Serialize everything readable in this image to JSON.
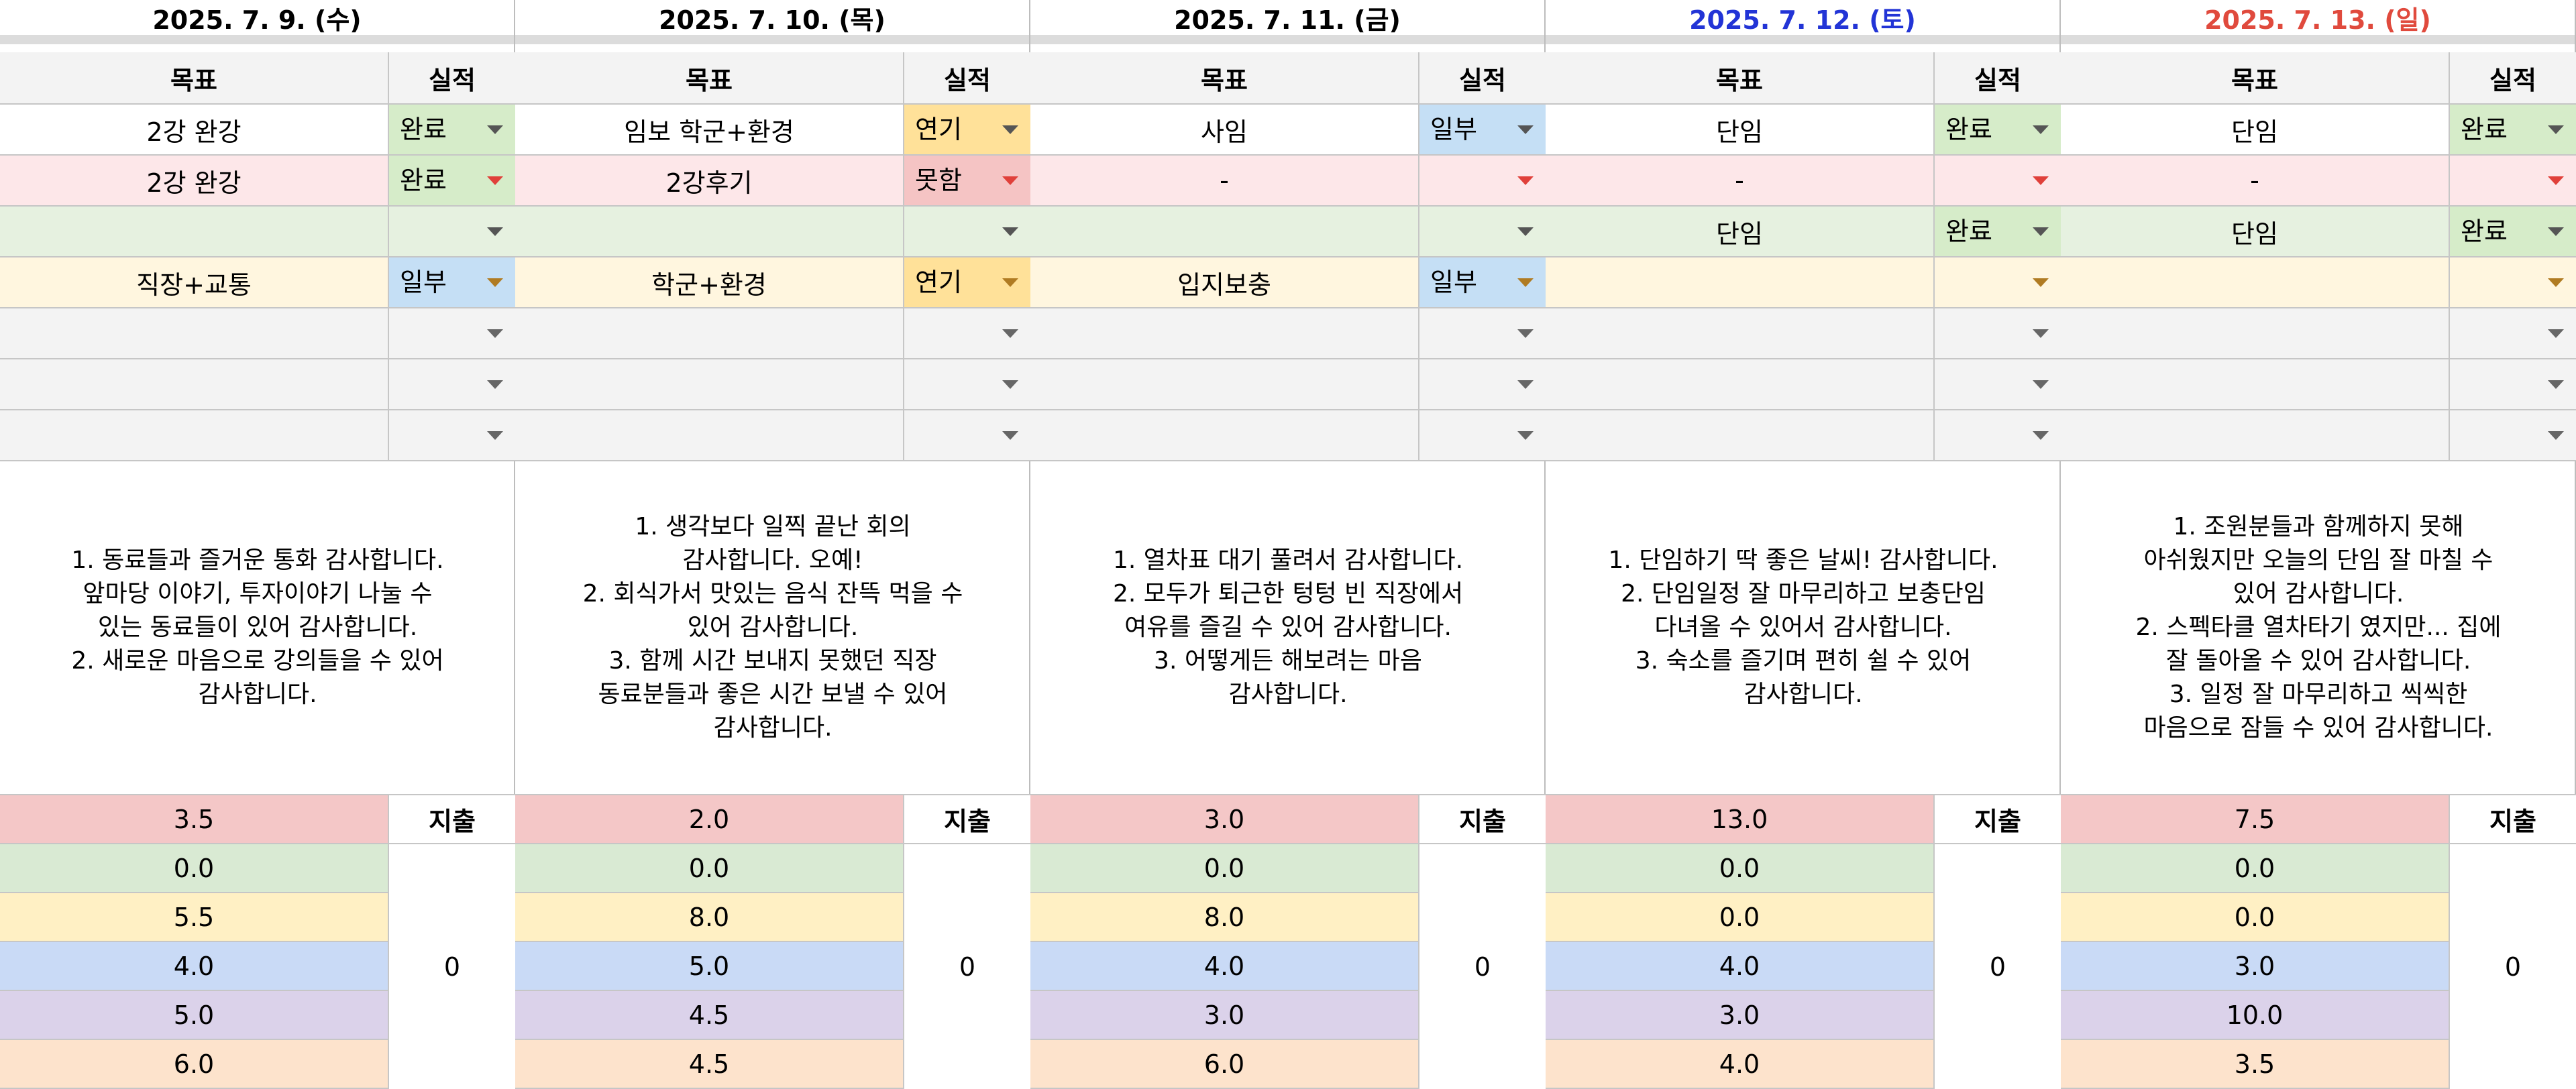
{
  "headers": {
    "goal": "목표",
    "result": "실적",
    "spend": "지출"
  },
  "colors": {
    "row_bg": [
      "#ffffff",
      "#fde7e9",
      "#e6f1e0",
      "#fff6df",
      "#f3f3f3",
      "#f3f3f3",
      "#f3f3f3"
    ],
    "num_bg": [
      "#f4c7c7",
      "#d9ead3",
      "#fff0c4",
      "#c9daf6",
      "#dbd2ea",
      "#fde3cc"
    ],
    "chip": {
      "완료": "#d6ecc9",
      "연기": "#ffe199",
      "일부": "#c5dff5",
      "못함": "#f5c4c4"
    },
    "date_colors": [
      "#000000",
      "#000000",
      "#000000",
      "#2234d6",
      "#e04a3d"
    ]
  },
  "days": [
    {
      "date": "2025. 7. 9. (수)",
      "rows": [
        {
          "goal": "2강 완강",
          "result": "완료"
        },
        {
          "goal": "2강 완강",
          "result": "완료"
        },
        {
          "goal": "",
          "result": ""
        },
        {
          "goal": "직장+교통",
          "result": "일부"
        },
        {
          "goal": "",
          "result": ""
        },
        {
          "goal": "",
          "result": ""
        },
        {
          "goal": "",
          "result": ""
        }
      ],
      "gratitude": [
        "1. 동료들과 즐거운 통화 감사합니다.",
        "앞마당 이야기, 투자이야기 나눌 수",
        "있는 동료들이 있어 감사합니다.",
        "2. 새로운 마음으로 강의들을 수 있어",
        "감사합니다."
      ],
      "numbers": [
        "3.5",
        "0.0",
        "5.5",
        "4.0",
        "5.0",
        "6.0"
      ],
      "spend": "0"
    },
    {
      "date": "2025. 7. 10. (목)",
      "rows": [
        {
          "goal": "임보 학군+환경",
          "result": "연기"
        },
        {
          "goal": "2강후기",
          "result": "못함"
        },
        {
          "goal": "",
          "result": ""
        },
        {
          "goal": "학군+환경",
          "result": "연기"
        },
        {
          "goal": "",
          "result": ""
        },
        {
          "goal": "",
          "result": ""
        },
        {
          "goal": "",
          "result": ""
        }
      ],
      "gratitude": [
        "1. 생각보다 일찍 끝난 회의",
        "감사합니다. 오예!",
        "2. 회식가서 맛있는 음식 잔뜩 먹을 수",
        "있어 감사합니다.",
        "3. 함께 시간 보내지 못했던 직장",
        "동료분들과 좋은 시간 보낼 수 있어",
        "감사합니다."
      ],
      "numbers": [
        "2.0",
        "0.0",
        "8.0",
        "5.0",
        "4.5",
        "4.5"
      ],
      "spend": "0"
    },
    {
      "date": "2025. 7. 11. (금)",
      "rows": [
        {
          "goal": "사임",
          "result": "일부"
        },
        {
          "goal": "-",
          "result": ""
        },
        {
          "goal": "",
          "result": ""
        },
        {
          "goal": "입지보충",
          "result": "일부"
        },
        {
          "goal": "",
          "result": ""
        },
        {
          "goal": "",
          "result": ""
        },
        {
          "goal": "",
          "result": ""
        }
      ],
      "gratitude": [
        "1. 열차표 대기 풀려서 감사합니다.",
        "2. 모두가 퇴근한 텅텅 빈 직장에서",
        "여유를 즐길 수 있어 감사합니다.",
        "3. 어떻게든 해보려는 마음",
        "감사합니다."
      ],
      "numbers": [
        "3.0",
        "0.0",
        "8.0",
        "4.0",
        "3.0",
        "6.0"
      ],
      "spend": "0"
    },
    {
      "date": "2025. 7. 12. (토)",
      "rows": [
        {
          "goal": "단임",
          "result": "완료"
        },
        {
          "goal": "-",
          "result": ""
        },
        {
          "goal": "단임",
          "result": "완료"
        },
        {
          "goal": "",
          "result": ""
        },
        {
          "goal": "",
          "result": ""
        },
        {
          "goal": "",
          "result": ""
        },
        {
          "goal": "",
          "result": ""
        }
      ],
      "gratitude": [
        "1. 단임하기 딱 좋은 날씨! 감사합니다.",
        "2. 단임일정 잘 마무리하고 보충단임",
        "다녀올 수 있어서 감사합니다.",
        "3. 숙소를 즐기며 편히 쉴 수 있어",
        "감사합니다."
      ],
      "numbers": [
        "13.0",
        "0.0",
        "0.0",
        "4.0",
        "3.0",
        "4.0"
      ],
      "spend": "0"
    },
    {
      "date": "2025. 7. 13. (일)",
      "rows": [
        {
          "goal": "단임",
          "result": "완료"
        },
        {
          "goal": "-",
          "result": ""
        },
        {
          "goal": "단임",
          "result": "완료"
        },
        {
          "goal": "",
          "result": ""
        },
        {
          "goal": "",
          "result": ""
        },
        {
          "goal": "",
          "result": ""
        },
        {
          "goal": "",
          "result": ""
        }
      ],
      "gratitude": [
        "1. 조원분들과 함께하지 못해",
        "아쉬웠지만 오늘의 단임 잘 마칠 수",
        "있어 감사합니다.",
        "2. 스펙타클 열차타기 였지만... 집에",
        "잘 돌아올 수 있어 감사합니다.",
        "3. 일정 잘 마무리하고 씩씩한",
        "마음으로 잠들 수 있어 감사합니다."
      ],
      "numbers": [
        "7.5",
        "0.0",
        "0.0",
        "3.0",
        "10.0",
        "3.5"
      ],
      "spend": "0"
    }
  ]
}
